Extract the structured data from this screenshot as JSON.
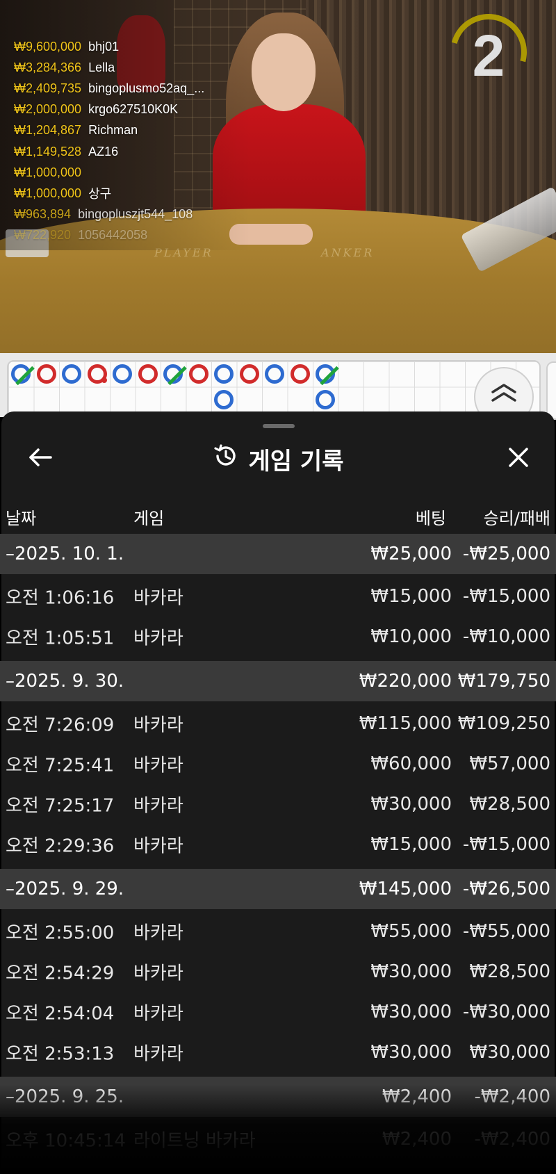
{
  "live": {
    "winners": [
      {
        "amount": "₩9,600,000",
        "name": "bhj01"
      },
      {
        "amount": "₩3,284,366",
        "name": "Lella"
      },
      {
        "amount": "₩2,409,735",
        "name": "bingoplusmo52aq_..."
      },
      {
        "amount": "₩2,000,000",
        "name": "krgo627510K0K"
      },
      {
        "amount": "₩1,204,867",
        "name": "Richman"
      },
      {
        "amount": "₩1,149,528",
        "name": "AZ16"
      },
      {
        "amount": "₩1,000,000",
        "name": ""
      },
      {
        "amount": "₩1,000,000",
        "name": "상구"
      },
      {
        "amount": "₩963,894",
        "name": "bingopluszjt544_108"
      },
      {
        "amount": "₩722,920",
        "name": "1056442058"
      }
    ],
    "countdown": "2",
    "table_labels": {
      "player": "PLAYER",
      "banker": "ANKER"
    }
  },
  "road": {
    "beads": [
      {
        "color": "blue",
        "tie": true
      },
      {
        "color": "red"
      },
      {
        "color": "blue"
      },
      {
        "color": "red",
        "pair": true
      },
      {
        "color": "blue"
      },
      {
        "color": "red"
      },
      {
        "color": "blue",
        "tie": true
      },
      {
        "color": "red"
      },
      {
        "color": "blue"
      },
      {
        "color": "red"
      },
      {
        "color": "blue"
      },
      {
        "color": "red"
      },
      {
        "color": "blue",
        "tie": true
      }
    ],
    "second_row": [
      {
        "column": 8,
        "color": "blue"
      },
      {
        "column": 12,
        "color": "blue"
      }
    ]
  },
  "sheet": {
    "title": "게임 기록",
    "icons": {
      "back": "arrow-left-icon",
      "history": "history-icon",
      "close": "close-icon",
      "expand": "chevron-double-up-icon"
    },
    "columns": {
      "date": "날짜",
      "game": "게임",
      "bet": "베팅",
      "result": "승리/패배"
    },
    "days": [
      {
        "date": "–2025. 10. 1.",
        "bet": "₩25,000",
        "result": "-₩25,000",
        "rows": [
          {
            "time": "오전 1:06:16",
            "game": "바카라",
            "bet": "₩15,000",
            "result": "-₩15,000"
          },
          {
            "time": "오전 1:05:51",
            "game": "바카라",
            "bet": "₩10,000",
            "result": "-₩10,000"
          }
        ]
      },
      {
        "date": "–2025. 9. 30.",
        "bet": "₩220,000",
        "result": "₩179,750",
        "rows": [
          {
            "time": "오전 7:26:09",
            "game": "바카라",
            "bet": "₩115,000",
            "result": "₩109,250"
          },
          {
            "time": "오전 7:25:41",
            "game": "바카라",
            "bet": "₩60,000",
            "result": "₩57,000"
          },
          {
            "time": "오전 7:25:17",
            "game": "바카라",
            "bet": "₩30,000",
            "result": "₩28,500"
          },
          {
            "time": "오전 2:29:36",
            "game": "바카라",
            "bet": "₩15,000",
            "result": "-₩15,000"
          }
        ]
      },
      {
        "date": "–2025. 9. 29.",
        "bet": "₩145,000",
        "result": "-₩26,500",
        "rows": [
          {
            "time": "오전 2:55:00",
            "game": "바카라",
            "bet": "₩55,000",
            "result": "-₩55,000"
          },
          {
            "time": "오전 2:54:29",
            "game": "바카라",
            "bet": "₩30,000",
            "result": "₩28,500"
          },
          {
            "time": "오전 2:54:04",
            "game": "바카라",
            "bet": "₩30,000",
            "result": "-₩30,000"
          },
          {
            "time": "오전 2:53:13",
            "game": "바카라",
            "bet": "₩30,000",
            "result": "₩30,000"
          }
        ]
      },
      {
        "date": "–2025. 9. 25.",
        "bet": "₩2,400",
        "result": "-₩2,400",
        "rows": [
          {
            "time": "오후 10:45:14",
            "game": "라이트닝 바카라",
            "bet": "₩2,400",
            "result": "-₩2,400"
          }
        ]
      }
    ]
  }
}
